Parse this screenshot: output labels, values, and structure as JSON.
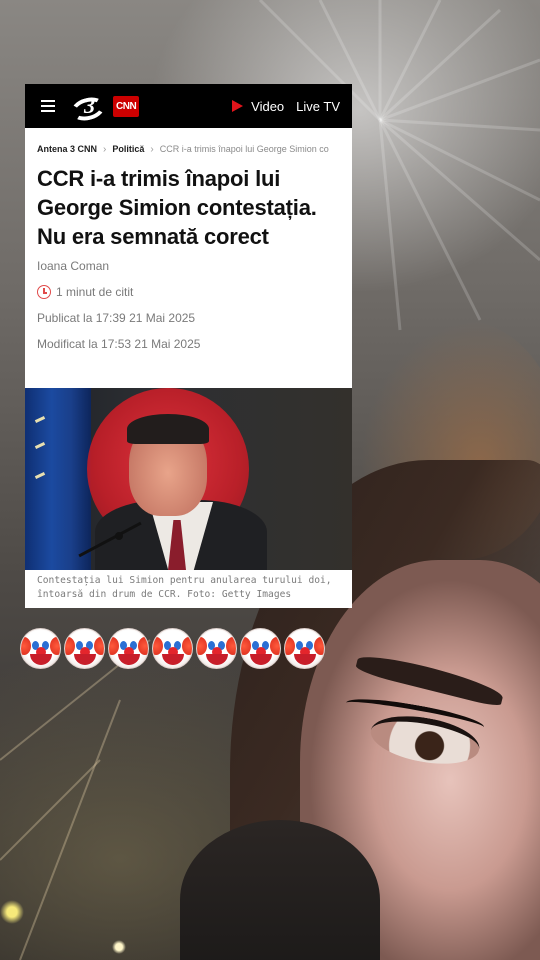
{
  "site": {
    "logo_number": "3",
    "logo_brand": "CNN",
    "nav_video": "Video",
    "nav_live": "Live TV"
  },
  "breadcrumb": [
    "Antena 3 CNN",
    "Politică",
    "CCR i-a trimis înapoi lui George Simion co"
  ],
  "article": {
    "headline": "CCR i-a trimis înapoi lui George Simion contestația. Nu era semnată corect",
    "author": "Ioana Coman",
    "read_time": "1 minut de citit",
    "published": "Publicat la 17:39 21 Mai 2025",
    "modified": "Modificat la 17:53 21 Mai 2025",
    "caption": "Contestația lui Simion pentru anularea turului doi, întoarsă din drum de CCR. Foto: Getty Images"
  },
  "emojis": [
    "clown-face",
    "clown-face",
    "clown-face",
    "clown-face",
    "clown-face",
    "clown-face",
    "clown-face"
  ],
  "colors": {
    "topbar": "#000000",
    "cnn_red": "#cc0000",
    "play_red": "#e3141b",
    "headline": "#111111",
    "meta": "#7a7a7a"
  }
}
